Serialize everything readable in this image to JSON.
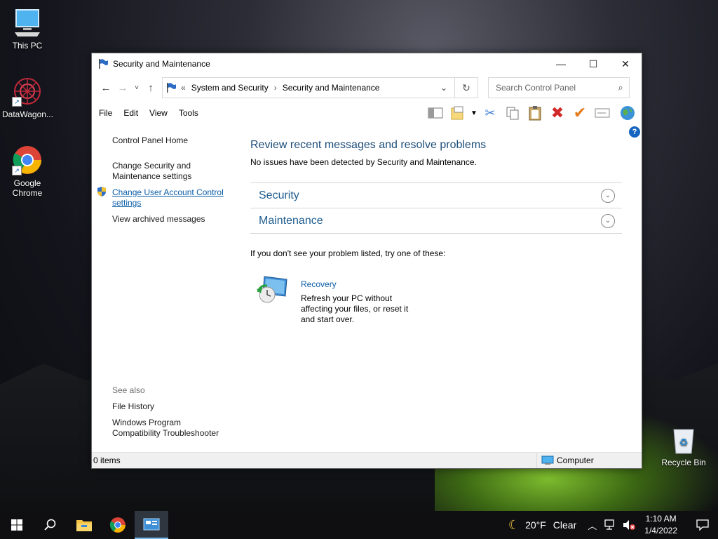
{
  "desktop": {
    "icons": [
      {
        "label": "This PC"
      },
      {
        "label": "DataWagon..."
      },
      {
        "label": "Google\nChrome"
      },
      {
        "label": "Recycle Bin"
      }
    ]
  },
  "window": {
    "title": "Security and Maintenance",
    "breadcrumb": {
      "overflow": "«",
      "items": [
        "System and Security",
        "Security and Maintenance"
      ]
    },
    "search_placeholder": "Search Control Panel",
    "menu": [
      "File",
      "Edit",
      "View",
      "Tools"
    ],
    "left_nav": {
      "home": "Control Panel Home",
      "change_security_l1": "Change Security and",
      "change_security_l2": "Maintenance settings",
      "uac_l1": "Change User Account Control",
      "uac_l2": "settings",
      "archived": "View archived messages",
      "see_also": "See also",
      "file_history": "File History",
      "compat_l1": "Windows Program",
      "compat_l2": "Compatibility Troubleshooter"
    },
    "main": {
      "heading": "Review recent messages and resolve problems",
      "subtext": "No issues have been detected by Security and Maintenance.",
      "sections": [
        {
          "title": "Security"
        },
        {
          "title": "Maintenance"
        }
      ],
      "hint": "If you don't see your problem listed, try one of these:",
      "recovery": {
        "title": "Recovery",
        "description": "Refresh your PC without affecting your files, or reset it and start over."
      }
    },
    "status": {
      "items": "0 items",
      "location": "Computer"
    }
  },
  "taskbar": {
    "weather_temp": "20°F",
    "weather_desc": "Clear",
    "time": "1:10 AM",
    "date": "1/4/2022"
  },
  "colors": {
    "link": "#0b5ea8",
    "heading": "#1e4e79",
    "taskbar": "#0f0f11"
  }
}
